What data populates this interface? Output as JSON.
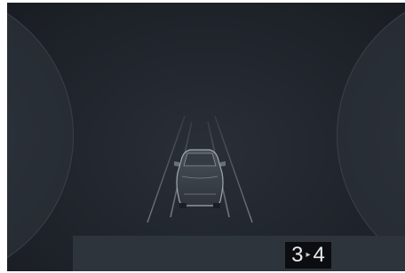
{
  "cluster": {
    "gear_current": "3",
    "gear_arrow": "▸",
    "gear_next": "4",
    "icons": {
      "vehicle": "car-rear-icon",
      "lanes": "lane-lines-icon"
    },
    "colors": {
      "background": "#20252c",
      "gauge_face": "#262b32",
      "line": "#8e949b",
      "gear_box": "#0b0d10",
      "gear_text": "#e9ecef"
    }
  }
}
